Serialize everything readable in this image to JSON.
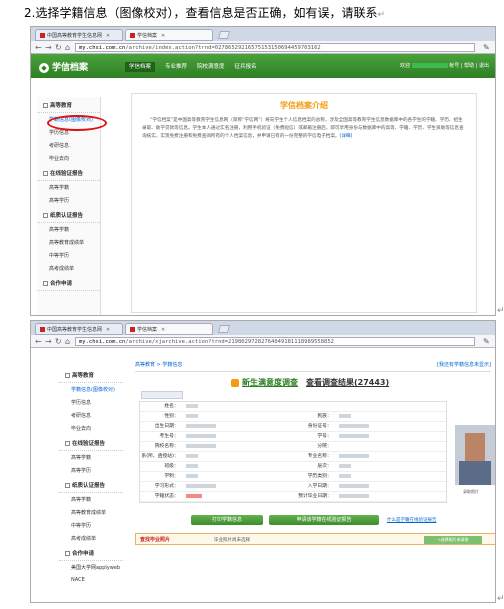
{
  "heading": {
    "number": "2.",
    "text": "选择学籍信息（图像校对），查看信息是否正确，如有误，请联系"
  },
  "browser1": {
    "tabs": [
      {
        "label": "中国高等教育学生信息网"
      },
      {
        "label": "学信档案"
      }
    ],
    "url_host": "my.chsi.com.cn",
    "url_path": "/archive/index.action?trnd=02786529216575153150694459703162"
  },
  "site": {
    "logo": "学信档案",
    "nav": [
      "学信档案",
      "专业推荐",
      "院校满意度",
      "征兵报名"
    ],
    "welcome_prefix": "欢迎",
    "account_links": [
      "帐号",
      "帮助",
      "退出"
    ]
  },
  "leftnav1": [
    {
      "section": "高等教育",
      "items": [
        "学籍信息(图像校对)",
        "学历信息",
        "考研信息",
        "毕业去向"
      ]
    },
    {
      "section": "在线验证报告",
      "items": [
        "高等学籍",
        "高等学历"
      ]
    },
    {
      "section": "纸质认证报告",
      "items": [
        "高等学籍",
        "高等教育成绩单",
        "中等学历",
        "高考成绩单"
      ]
    },
    {
      "section": "合作申请",
      "items": []
    }
  ],
  "intro": {
    "title": "学信档案介绍",
    "body": "“学信档案”是中国高等教育学生信息网（简称“学信网”）将向学生个人信息档案的总称，涉及全国高等教育学生信息数据库中的各学生的学籍、学历、招生录取、助学贷款等信息。学生本人通过实名注册，利用手机验证（免费短信）或邮箱注册后，即可享用身份与数据库中的高等、学籍、学历、学生资助等信息查询核实，实现免费注册和免费查阅所有的个人档案信息，并申请已有的一份完整的学信电子档案。",
    "more": "[详细]"
  },
  "browser2": {
    "tabs": [
      {
        "label": "中国高等教育学生信息网"
      },
      {
        "label": "学信档案"
      }
    ],
    "url_host": "my.chsi.com.cn",
    "url_path": "/archive/xjarchive.action?trnd=21980297282764049181118989558852"
  },
  "leftnav2": [
    {
      "section": "高等教育",
      "items": [
        "学籍信息(图像校对)",
        "学历信息",
        "考研信息",
        "毕业去向"
      ]
    },
    {
      "section": "在线验证报告",
      "items": [
        "高等学籍",
        "高等学历"
      ]
    },
    {
      "section": "纸质认证报告",
      "items": [
        "高等学籍",
        "高等教育成绩单",
        "中等学历",
        "高考成绩单"
      ]
    },
    {
      "section": "合作申请",
      "items": [
        "美国大学网applyweb",
        "NACE"
      ]
    }
  ],
  "crumb": {
    "path": "高等教育 > 学籍信息",
    "right": "[我还有学籍信息未显示]"
  },
  "survey": {
    "link": "新生满意度调查",
    "result": "查看调查结果(27443)"
  },
  "record_rows": [
    {
      "left": "姓名：",
      "right": ""
    },
    {
      "left": "性别：",
      "right": "民族："
    },
    {
      "left": "出生日期：",
      "right": "身份证号："
    },
    {
      "left": "考生号：",
      "right": "学号："
    },
    {
      "left": "院校名称：",
      "right": "分院："
    },
    {
      "left": "系(所、函授站)：",
      "right": "专业名称："
    },
    {
      "left": "班级：",
      "right": "层次："
    },
    {
      "left": "学制：",
      "right": "学历类别："
    },
    {
      "left": "学习形式：",
      "right": "入学日期："
    },
    {
      "left": "学籍状态：",
      "right": "预计毕业日期："
    }
  ],
  "photo_caption": "录取照片",
  "buttons": [
    "打印学籍信息",
    "申请该学籍在线验证报告"
  ],
  "help_link": "什么是学籍在线验证报告",
  "bottom": {
    "title": "查找毕业照片",
    "text": "毕业照片尚未选择",
    "button": "→选择照片来录取"
  },
  "cursor_mark": "↵"
}
